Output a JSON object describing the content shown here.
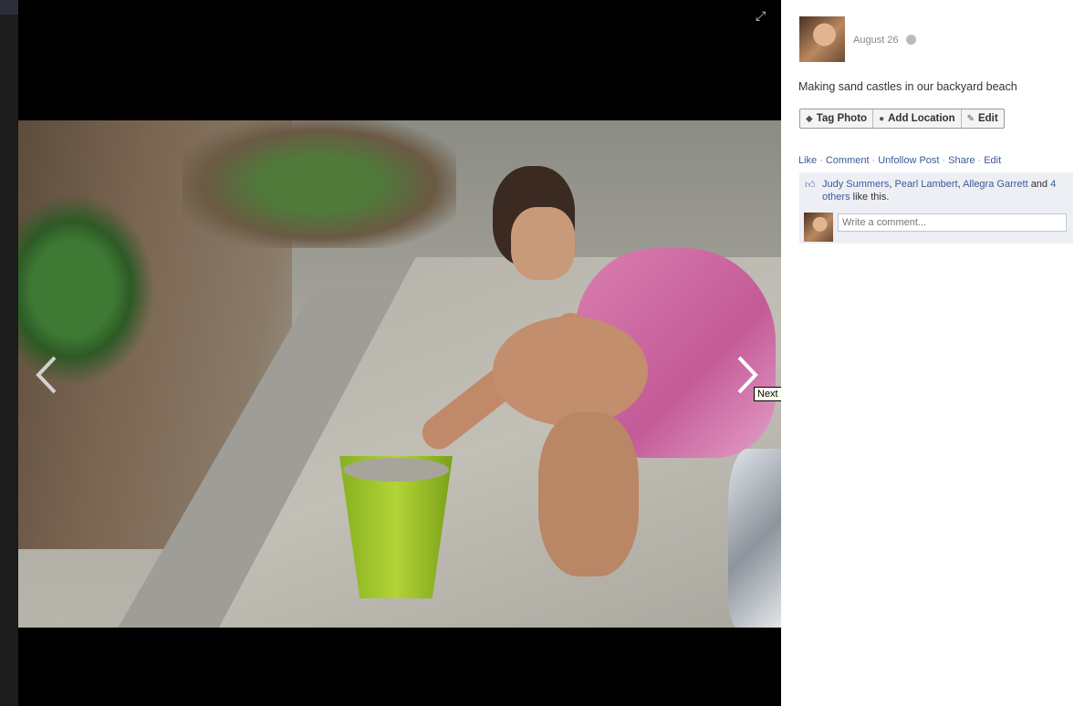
{
  "viewer": {
    "next_tooltip": "Next",
    "icons": {
      "expand": "expand-icon",
      "prev": "chevron-left-icon",
      "next": "chevron-right-icon"
    }
  },
  "post": {
    "date": "August 26",
    "caption": "Making sand castles in our backyard beach",
    "actions": {
      "tag_photo": "Tag Photo",
      "add_location": "Add Location",
      "edit": "Edit"
    },
    "links": {
      "like": "Like",
      "comment": "Comment",
      "unfollow": "Unfollow Post",
      "share": "Share",
      "edit": "Edit",
      "separator": "·"
    },
    "likes": {
      "names": [
        "Judy Summers",
        "Pearl Lambert",
        "Allegra Garrett"
      ],
      "comma": ",",
      "and": "and",
      "others_count": "4",
      "others_word": "others",
      "suffix": "like this."
    },
    "comment_placeholder": "Write a comment..."
  },
  "colors": {
    "link": "#3b5998",
    "likes_bg": "#edeff4"
  }
}
